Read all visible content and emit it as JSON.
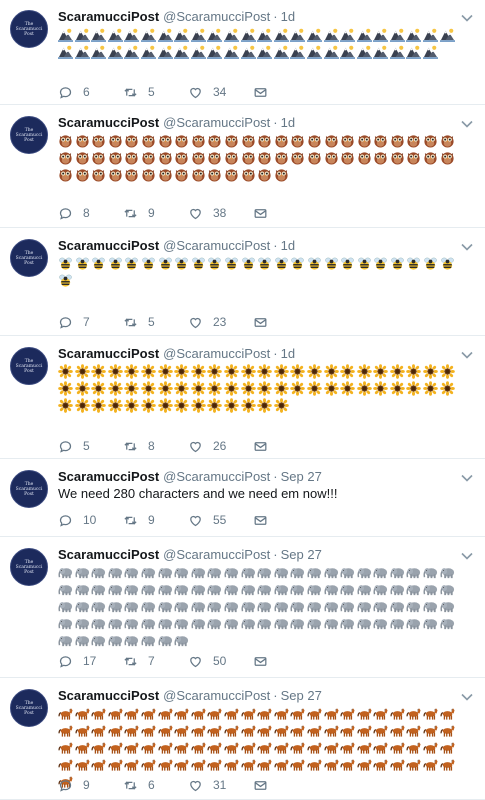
{
  "feed": {
    "tweets": [
      {
        "name": "ScaramucciPost",
        "handle": "@ScaramucciPost",
        "time": "1d",
        "emoji_name": "mountain-snow",
        "emoji_count": 47,
        "replies": "6",
        "retweets": "5",
        "likes": "34"
      },
      {
        "name": "ScaramucciPost",
        "handle": "@ScaramucciPost",
        "time": "1d",
        "emoji_name": "owl",
        "emoji_count": 62,
        "replies": "8",
        "retweets": "9",
        "likes": "38"
      },
      {
        "name": "ScaramucciPost",
        "handle": "@ScaramucciPost",
        "time": "1d",
        "emoji_name": "bee",
        "emoji_count": 25,
        "replies": "7",
        "retweets": "5",
        "likes": "23"
      },
      {
        "name": "ScaramucciPost",
        "handle": "@ScaramucciPost",
        "time": "1d",
        "emoji_name": "sunflower",
        "emoji_count": 62,
        "replies": "5",
        "retweets": "8",
        "likes": "26"
      },
      {
        "name": "ScaramucciPost",
        "handle": "@ScaramucciPost",
        "time": "Sep 27",
        "text": "We need 280 characters and we need em now!!!",
        "replies": "10",
        "retweets": "9",
        "likes": "55"
      },
      {
        "name": "ScaramucciPost",
        "handle": "@ScaramucciPost",
        "time": "Sep 27",
        "emoji_name": "elephant",
        "emoji_count": 104,
        "replies": "17",
        "retweets": "7",
        "likes": "50"
      },
      {
        "name": "ScaramucciPost",
        "handle": "@ScaramucciPost",
        "time": "Sep 27",
        "emoji_name": "horse",
        "emoji_count": 97,
        "replies": "9",
        "retweets": "6",
        "likes": "31"
      }
    ]
  },
  "avatar_text": "The\nScaramucci\nPost",
  "separator": "·",
  "colors": {
    "text": "#14171a",
    "muted": "#657786",
    "border": "#e6ecf0",
    "avatar": "#1c2a5c"
  }
}
